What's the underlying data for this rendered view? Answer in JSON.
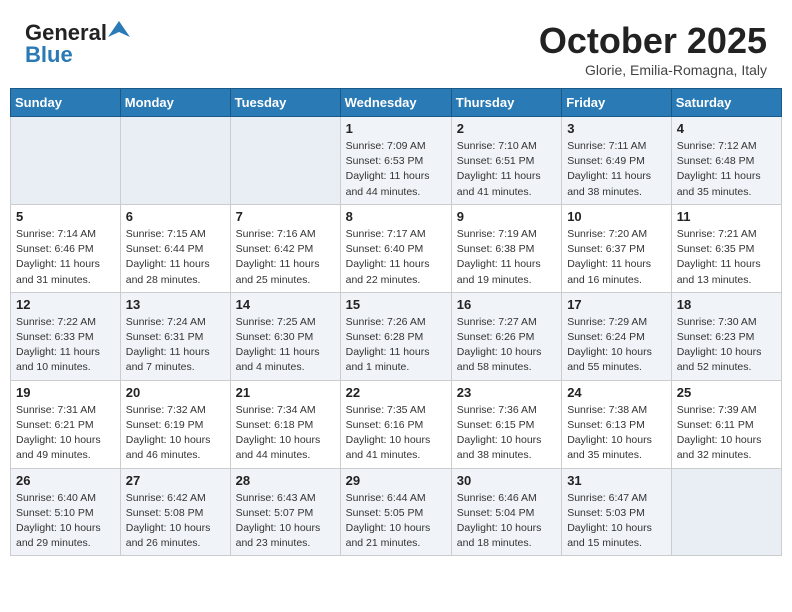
{
  "header": {
    "logo_general": "General",
    "logo_blue": "Blue",
    "month": "October 2025",
    "location": "Glorie, Emilia-Romagna, Italy"
  },
  "weekdays": [
    "Sunday",
    "Monday",
    "Tuesday",
    "Wednesday",
    "Thursday",
    "Friday",
    "Saturday"
  ],
  "weeks": [
    [
      {
        "day": "",
        "info": ""
      },
      {
        "day": "",
        "info": ""
      },
      {
        "day": "",
        "info": ""
      },
      {
        "day": "1",
        "info": "Sunrise: 7:09 AM\nSunset: 6:53 PM\nDaylight: 11 hours\nand 44 minutes."
      },
      {
        "day": "2",
        "info": "Sunrise: 7:10 AM\nSunset: 6:51 PM\nDaylight: 11 hours\nand 41 minutes."
      },
      {
        "day": "3",
        "info": "Sunrise: 7:11 AM\nSunset: 6:49 PM\nDaylight: 11 hours\nand 38 minutes."
      },
      {
        "day": "4",
        "info": "Sunrise: 7:12 AM\nSunset: 6:48 PM\nDaylight: 11 hours\nand 35 minutes."
      }
    ],
    [
      {
        "day": "5",
        "info": "Sunrise: 7:14 AM\nSunset: 6:46 PM\nDaylight: 11 hours\nand 31 minutes."
      },
      {
        "day": "6",
        "info": "Sunrise: 7:15 AM\nSunset: 6:44 PM\nDaylight: 11 hours\nand 28 minutes."
      },
      {
        "day": "7",
        "info": "Sunrise: 7:16 AM\nSunset: 6:42 PM\nDaylight: 11 hours\nand 25 minutes."
      },
      {
        "day": "8",
        "info": "Sunrise: 7:17 AM\nSunset: 6:40 PM\nDaylight: 11 hours\nand 22 minutes."
      },
      {
        "day": "9",
        "info": "Sunrise: 7:19 AM\nSunset: 6:38 PM\nDaylight: 11 hours\nand 19 minutes."
      },
      {
        "day": "10",
        "info": "Sunrise: 7:20 AM\nSunset: 6:37 PM\nDaylight: 11 hours\nand 16 minutes."
      },
      {
        "day": "11",
        "info": "Sunrise: 7:21 AM\nSunset: 6:35 PM\nDaylight: 11 hours\nand 13 minutes."
      }
    ],
    [
      {
        "day": "12",
        "info": "Sunrise: 7:22 AM\nSunset: 6:33 PM\nDaylight: 11 hours\nand 10 minutes."
      },
      {
        "day": "13",
        "info": "Sunrise: 7:24 AM\nSunset: 6:31 PM\nDaylight: 11 hours\nand 7 minutes."
      },
      {
        "day": "14",
        "info": "Sunrise: 7:25 AM\nSunset: 6:30 PM\nDaylight: 11 hours\nand 4 minutes."
      },
      {
        "day": "15",
        "info": "Sunrise: 7:26 AM\nSunset: 6:28 PM\nDaylight: 11 hours\nand 1 minute."
      },
      {
        "day": "16",
        "info": "Sunrise: 7:27 AM\nSunset: 6:26 PM\nDaylight: 10 hours\nand 58 minutes."
      },
      {
        "day": "17",
        "info": "Sunrise: 7:29 AM\nSunset: 6:24 PM\nDaylight: 10 hours\nand 55 minutes."
      },
      {
        "day": "18",
        "info": "Sunrise: 7:30 AM\nSunset: 6:23 PM\nDaylight: 10 hours\nand 52 minutes."
      }
    ],
    [
      {
        "day": "19",
        "info": "Sunrise: 7:31 AM\nSunset: 6:21 PM\nDaylight: 10 hours\nand 49 minutes."
      },
      {
        "day": "20",
        "info": "Sunrise: 7:32 AM\nSunset: 6:19 PM\nDaylight: 10 hours\nand 46 minutes."
      },
      {
        "day": "21",
        "info": "Sunrise: 7:34 AM\nSunset: 6:18 PM\nDaylight: 10 hours\nand 44 minutes."
      },
      {
        "day": "22",
        "info": "Sunrise: 7:35 AM\nSunset: 6:16 PM\nDaylight: 10 hours\nand 41 minutes."
      },
      {
        "day": "23",
        "info": "Sunrise: 7:36 AM\nSunset: 6:15 PM\nDaylight: 10 hours\nand 38 minutes."
      },
      {
        "day": "24",
        "info": "Sunrise: 7:38 AM\nSunset: 6:13 PM\nDaylight: 10 hours\nand 35 minutes."
      },
      {
        "day": "25",
        "info": "Sunrise: 7:39 AM\nSunset: 6:11 PM\nDaylight: 10 hours\nand 32 minutes."
      }
    ],
    [
      {
        "day": "26",
        "info": "Sunrise: 6:40 AM\nSunset: 5:10 PM\nDaylight: 10 hours\nand 29 minutes."
      },
      {
        "day": "27",
        "info": "Sunrise: 6:42 AM\nSunset: 5:08 PM\nDaylight: 10 hours\nand 26 minutes."
      },
      {
        "day": "28",
        "info": "Sunrise: 6:43 AM\nSunset: 5:07 PM\nDaylight: 10 hours\nand 23 minutes."
      },
      {
        "day": "29",
        "info": "Sunrise: 6:44 AM\nSunset: 5:05 PM\nDaylight: 10 hours\nand 21 minutes."
      },
      {
        "day": "30",
        "info": "Sunrise: 6:46 AM\nSunset: 5:04 PM\nDaylight: 10 hours\nand 18 minutes."
      },
      {
        "day": "31",
        "info": "Sunrise: 6:47 AM\nSunset: 5:03 PM\nDaylight: 10 hours\nand 15 minutes."
      },
      {
        "day": "",
        "info": ""
      }
    ]
  ]
}
